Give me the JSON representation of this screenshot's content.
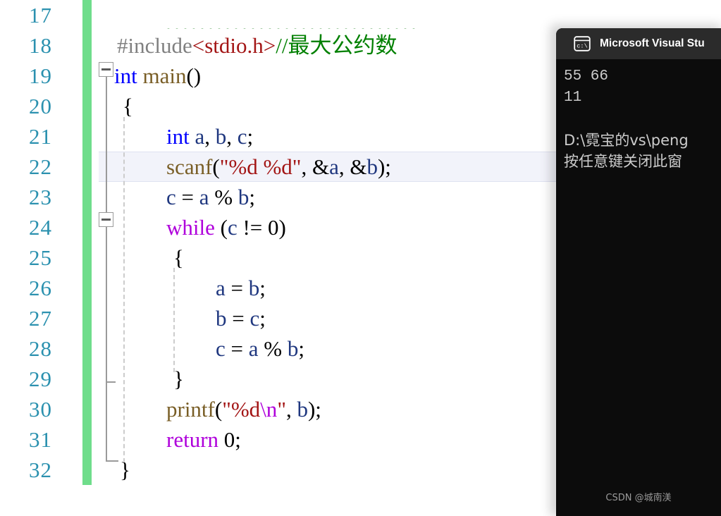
{
  "editor": {
    "name": "visual-studio-code-editor",
    "background": "#ffffff",
    "line_number_color": "#2b91af",
    "change_bar_color": "#6fdd8b",
    "current_line_highlight_color": "#f2f3fa",
    "lines": [
      {
        "no": "17",
        "tokens": []
      },
      {
        "no": "18",
        "tokens": [
          {
            "cls": "t-pre",
            "text": "#include"
          },
          {
            "cls": "t-str",
            "text": "<stdio.h>"
          },
          {
            "cls": "t-cmt",
            "text": "//最大公约数"
          }
        ]
      },
      {
        "no": "19",
        "tokens": [
          {
            "cls": "t-kw",
            "text": "int"
          },
          {
            "cls": "t-plain",
            "text": " "
          },
          {
            "cls": "t-fn",
            "text": "main"
          },
          {
            "cls": "t-plain",
            "text": "()"
          }
        ]
      },
      {
        "no": "20",
        "tokens": [
          {
            "cls": "t-plain",
            "text": "{"
          }
        ]
      },
      {
        "no": "21",
        "tokens": [
          {
            "cls": "t-kw",
            "text": "int"
          },
          {
            "cls": "t-plain",
            "text": " "
          },
          {
            "cls": "t-var",
            "text": "a"
          },
          {
            "cls": "t-plain",
            "text": ", "
          },
          {
            "cls": "t-var",
            "text": "b"
          },
          {
            "cls": "t-plain",
            "text": ", "
          },
          {
            "cls": "t-var",
            "text": "c"
          },
          {
            "cls": "t-plain",
            "text": ";"
          }
        ]
      },
      {
        "no": "22",
        "tokens": [
          {
            "cls": "t-fn",
            "text": "scanf"
          },
          {
            "cls": "t-plain",
            "text": "("
          },
          {
            "cls": "t-str",
            "text": "\"%d %d\""
          },
          {
            "cls": "t-plain",
            "text": ", &"
          },
          {
            "cls": "t-var",
            "text": "a"
          },
          {
            "cls": "t-plain",
            "text": ", &"
          },
          {
            "cls": "t-var",
            "text": "b"
          },
          {
            "cls": "t-plain",
            "text": ");"
          }
        ]
      },
      {
        "no": "23",
        "tokens": [
          {
            "cls": "t-var",
            "text": "c"
          },
          {
            "cls": "t-plain",
            "text": " = "
          },
          {
            "cls": "t-var",
            "text": "a"
          },
          {
            "cls": "t-plain",
            "text": " % "
          },
          {
            "cls": "t-var",
            "text": "b"
          },
          {
            "cls": "t-plain",
            "text": ";"
          }
        ]
      },
      {
        "no": "24",
        "tokens": [
          {
            "cls": "t-ctl",
            "text": "while"
          },
          {
            "cls": "t-plain",
            "text": " ("
          },
          {
            "cls": "t-var",
            "text": "c"
          },
          {
            "cls": "t-plain",
            "text": " != 0)"
          }
        ]
      },
      {
        "no": "25",
        "tokens": [
          {
            "cls": "t-plain",
            "text": "{"
          }
        ]
      },
      {
        "no": "26",
        "tokens": [
          {
            "cls": "t-var",
            "text": "a"
          },
          {
            "cls": "t-plain",
            "text": " = "
          },
          {
            "cls": "t-var",
            "text": "b"
          },
          {
            "cls": "t-plain",
            "text": ";"
          }
        ]
      },
      {
        "no": "27",
        "tokens": [
          {
            "cls": "t-var",
            "text": "b"
          },
          {
            "cls": "t-plain",
            "text": " = "
          },
          {
            "cls": "t-var",
            "text": "c"
          },
          {
            "cls": "t-plain",
            "text": ";"
          }
        ]
      },
      {
        "no": "28",
        "tokens": [
          {
            "cls": "t-var",
            "text": "c"
          },
          {
            "cls": "t-plain",
            "text": " = "
          },
          {
            "cls": "t-var",
            "text": "a"
          },
          {
            "cls": "t-plain",
            "text": " % "
          },
          {
            "cls": "t-var",
            "text": "b"
          },
          {
            "cls": "t-plain",
            "text": ";"
          }
        ]
      },
      {
        "no": "29",
        "tokens": [
          {
            "cls": "t-plain",
            "text": "}"
          }
        ]
      },
      {
        "no": "30",
        "tokens": [
          {
            "cls": "t-fn",
            "text": "printf"
          },
          {
            "cls": "t-plain",
            "text": "("
          },
          {
            "cls": "t-str",
            "text": "\"%d"
          },
          {
            "cls": "t-esc",
            "text": "\\n"
          },
          {
            "cls": "t-str",
            "text": "\""
          },
          {
            "cls": "t-plain",
            "text": ", "
          },
          {
            "cls": "t-var",
            "text": "b"
          },
          {
            "cls": "t-plain",
            "text": ");"
          }
        ]
      },
      {
        "no": "31",
        "tokens": [
          {
            "cls": "t-ctl",
            "text": "return"
          },
          {
            "cls": "t-plain",
            "text": " 0;"
          }
        ]
      },
      {
        "no": "32",
        "tokens": [
          {
            "cls": "t-plain",
            "text": "}"
          }
        ]
      }
    ],
    "current_line_index": 5
  },
  "console": {
    "title": "Microsoft Visual Stu",
    "icon": "console-terminal-icon",
    "titlebar_color": "#2b2b2b",
    "background": "#0c0c0c",
    "text_color": "#cccccc",
    "output_lines": [
      "55 66",
      "11",
      "",
      "D:\\霓宝的vs\\peng",
      "按任意键关闭此窗"
    ]
  },
  "watermark": {
    "text": "CSDN @城南渼"
  }
}
